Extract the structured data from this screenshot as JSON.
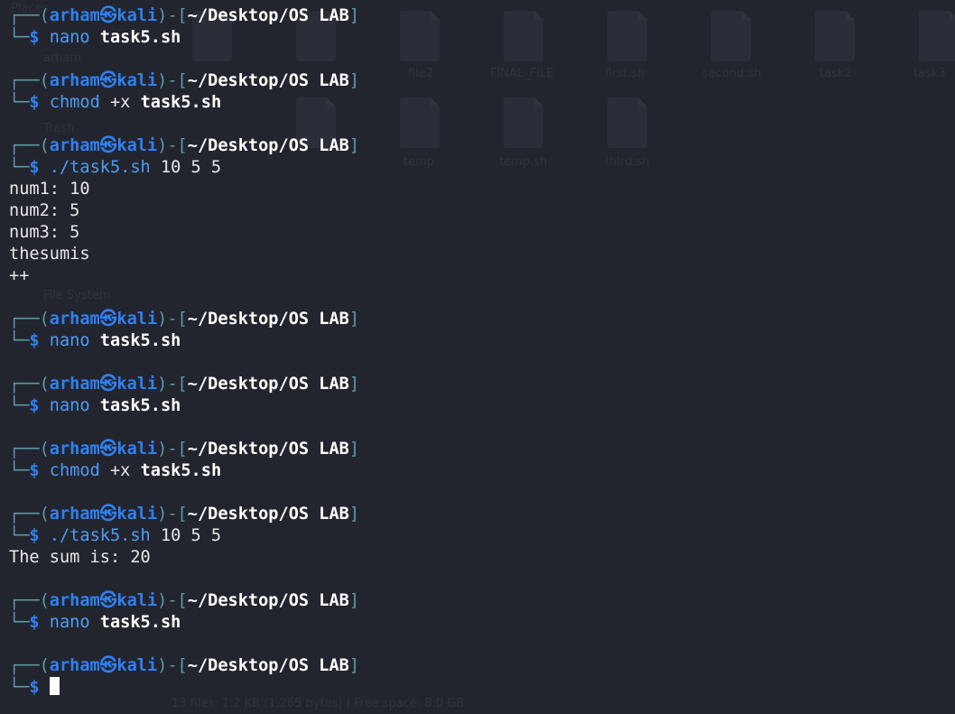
{
  "prompt": {
    "user": "arham",
    "at_glyph": "㉿",
    "host": "kali",
    "path": "~/Desktop/OS LAB",
    "open_paren": "┌──(",
    "close_paren": ")-[",
    "close_bracket": "]",
    "corner": "└─",
    "dollar": "$"
  },
  "blocks": [
    {
      "cmd": "nano",
      "args": "task5.sh",
      "args_style": "bold",
      "output": []
    },
    {
      "cmd": "chmod",
      "flags": "+x",
      "args": "task5.sh",
      "args_style": "bold",
      "output": []
    },
    {
      "cmd": "./task5.sh",
      "args": "10 5 5",
      "args_style": "plain",
      "output": [
        "num1: 10",
        "num2: 5",
        "num3: 5",
        "thesumis",
        "++"
      ]
    },
    {
      "cmd": "nano",
      "args": "task5.sh",
      "args_style": "bold",
      "output": []
    },
    {
      "cmd": "nano",
      "args": "task5.sh",
      "args_style": "bold",
      "output": []
    },
    {
      "cmd": "chmod",
      "flags": "+x",
      "args": "task5.sh",
      "args_style": "bold",
      "output": []
    },
    {
      "cmd": "./task5.sh",
      "args": "10 5 5",
      "args_style": "plain",
      "output": [
        "The sum is: 20"
      ]
    },
    {
      "cmd": "nano",
      "args": "task5.sh",
      "args_style": "bold",
      "output": []
    },
    {
      "cmd": "",
      "args": "",
      "args_style": "plain",
      "output": [],
      "cursor": true
    }
  ]
}
